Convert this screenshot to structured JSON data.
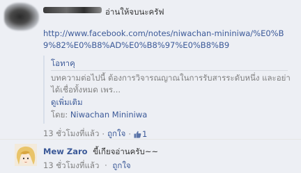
{
  "comments": [
    {
      "text": "อ่านให้จบนะครัฟ",
      "url": "http://www.facebook.com/notes/niwachan-mininiwa/%E0%B9%82%E0%B8%AD%E0%B8%97%E0%B8%B9",
      "preview": {
        "title": "โอทาคุ",
        "body": "บทความต่อไปนี้ ต้องการวิจารณญาณในการรับสารระดับหนึ่ง และอย่าได้เชื่อทั้งหมด เพร...",
        "see_more": "ดูเพิ่มเติม",
        "by_label": "โดย:",
        "author": "Niwachan Mininiwa"
      },
      "time": "13 ชั่วโมงที่แล้ว",
      "like_label": "ถูกใจ",
      "like_count": "1"
    },
    {
      "author": "Mew Zaro",
      "text": "ขี้เกียจอ่านครับ~~",
      "time": "13 ชั่วโมงที่แล้ว",
      "like_label": "ถูกใจ"
    }
  ],
  "separator": "·"
}
